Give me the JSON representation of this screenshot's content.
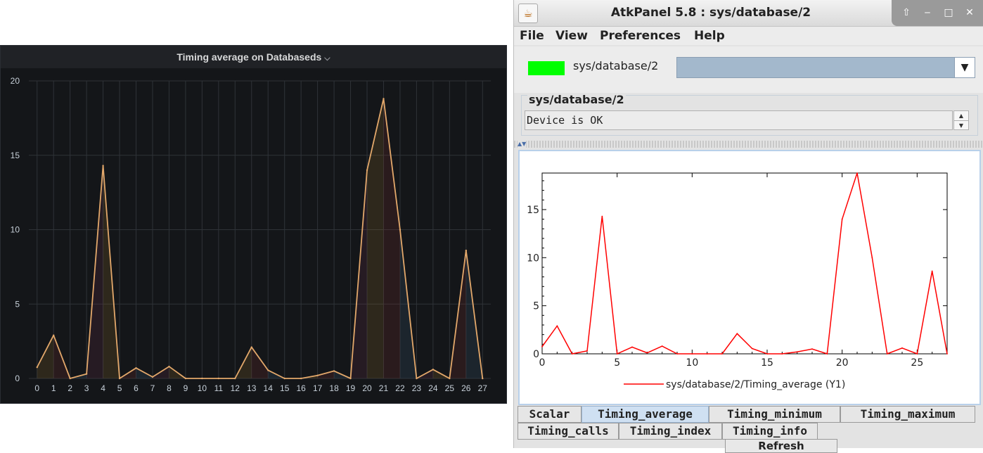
{
  "grafana": {
    "title": "Timing average on Databaseds",
    "title_chevron": "⌵",
    "line_color": "#e3a86b",
    "grid_color": "#2f3338",
    "chart_data": {
      "type": "line",
      "x": [
        0,
        1,
        2,
        3,
        4,
        5,
        6,
        7,
        8,
        9,
        10,
        11,
        12,
        13,
        14,
        15,
        16,
        17,
        18,
        19,
        20,
        21,
        22,
        23,
        24,
        25,
        26,
        27
      ],
      "series": [
        {
          "values": [
            0.75,
            2.9,
            0.0,
            0.3,
            14.3,
            0.0,
            0.7,
            0.1,
            0.8,
            0.0,
            0.0,
            0.0,
            0.0,
            2.1,
            0.55,
            0.0,
            0.0,
            0.2,
            0.5,
            0.0,
            14.0,
            18.8,
            10.0,
            0.0,
            0.6,
            0.0,
            8.6,
            0.0
          ]
        }
      ],
      "yticks": [
        0,
        5,
        10,
        15,
        20
      ],
      "ylim": [
        0,
        20
      ],
      "xlim": [
        -0.5,
        27.5
      ],
      "grid": true
    }
  },
  "atk": {
    "icon": "☕",
    "title": "AtkPanel 5.8 : sys/database/2",
    "window_buttons": {
      "up": "⇧",
      "minimize": "‒",
      "maximize": "□",
      "close": "✕"
    },
    "menu": [
      "File",
      "View",
      "Preferences",
      "Help"
    ],
    "device_name": "sys/database/2",
    "state_color": "#00ff00",
    "combo_arrow": "▼",
    "combo_value": "",
    "status_title": "sys/database/2",
    "status_text": "Device is OK",
    "spin_up": "▲",
    "spin_down": "▼",
    "split_arrows": "▲▼",
    "legend_label": "sys/database/2/Timing_average (Y1)",
    "line_color": "#ff0000",
    "chart_data": {
      "type": "line",
      "x": [
        0,
        1,
        2,
        3,
        4,
        5,
        6,
        7,
        8,
        9,
        10,
        11,
        12,
        13,
        14,
        15,
        16,
        17,
        18,
        19,
        20,
        21,
        22,
        23,
        24,
        25,
        26,
        27
      ],
      "series": [
        {
          "name": "sys/database/2/Timing_average (Y1)",
          "values": [
            0.75,
            2.9,
            0.0,
            0.3,
            14.3,
            0.0,
            0.7,
            0.1,
            0.8,
            0.0,
            0.0,
            0.0,
            0.0,
            2.1,
            0.55,
            0.0,
            0.0,
            0.2,
            0.5,
            0.0,
            14.0,
            18.8,
            10.0,
            0.0,
            0.6,
            0.0,
            8.6,
            0.0
          ]
        }
      ],
      "xticks": [
        0,
        5,
        10,
        15,
        20,
        25
      ],
      "yticks": [
        0,
        5,
        10,
        15
      ],
      "xlim": [
        0,
        27
      ],
      "ylim": [
        0,
        18.8
      ],
      "grid": false
    },
    "tabs_row1": [
      "Scalar",
      "Timing_average",
      "Timing_minimum",
      "Timing_maximum"
    ],
    "tabs_row2": [
      "Timing_calls",
      "Timing_index",
      "Timing_info"
    ],
    "active_tab": "Timing_average",
    "refresh_label": "Refresh"
  }
}
